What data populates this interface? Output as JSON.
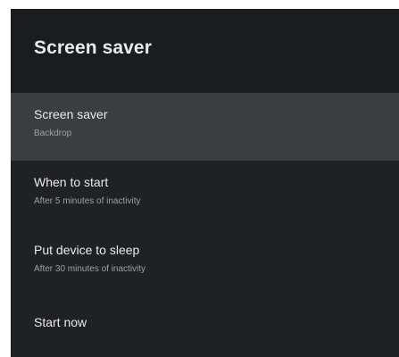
{
  "header": {
    "title": "Screen saver"
  },
  "menu": {
    "items": [
      {
        "title": "Screen saver",
        "subtitle": "Backdrop"
      },
      {
        "title": "When to start",
        "subtitle": "After 5 minutes of inactivity"
      },
      {
        "title": "Put device to sleep",
        "subtitle": "After 30 minutes of inactivity"
      },
      {
        "title": "Start now"
      }
    ]
  },
  "colors": {
    "panel_background": "#202124",
    "header_background": "#1b1c1f",
    "selected_item_background": "#3b3d41",
    "primary_text": "#e8eaed",
    "secondary_text": "#9aa0a6"
  }
}
